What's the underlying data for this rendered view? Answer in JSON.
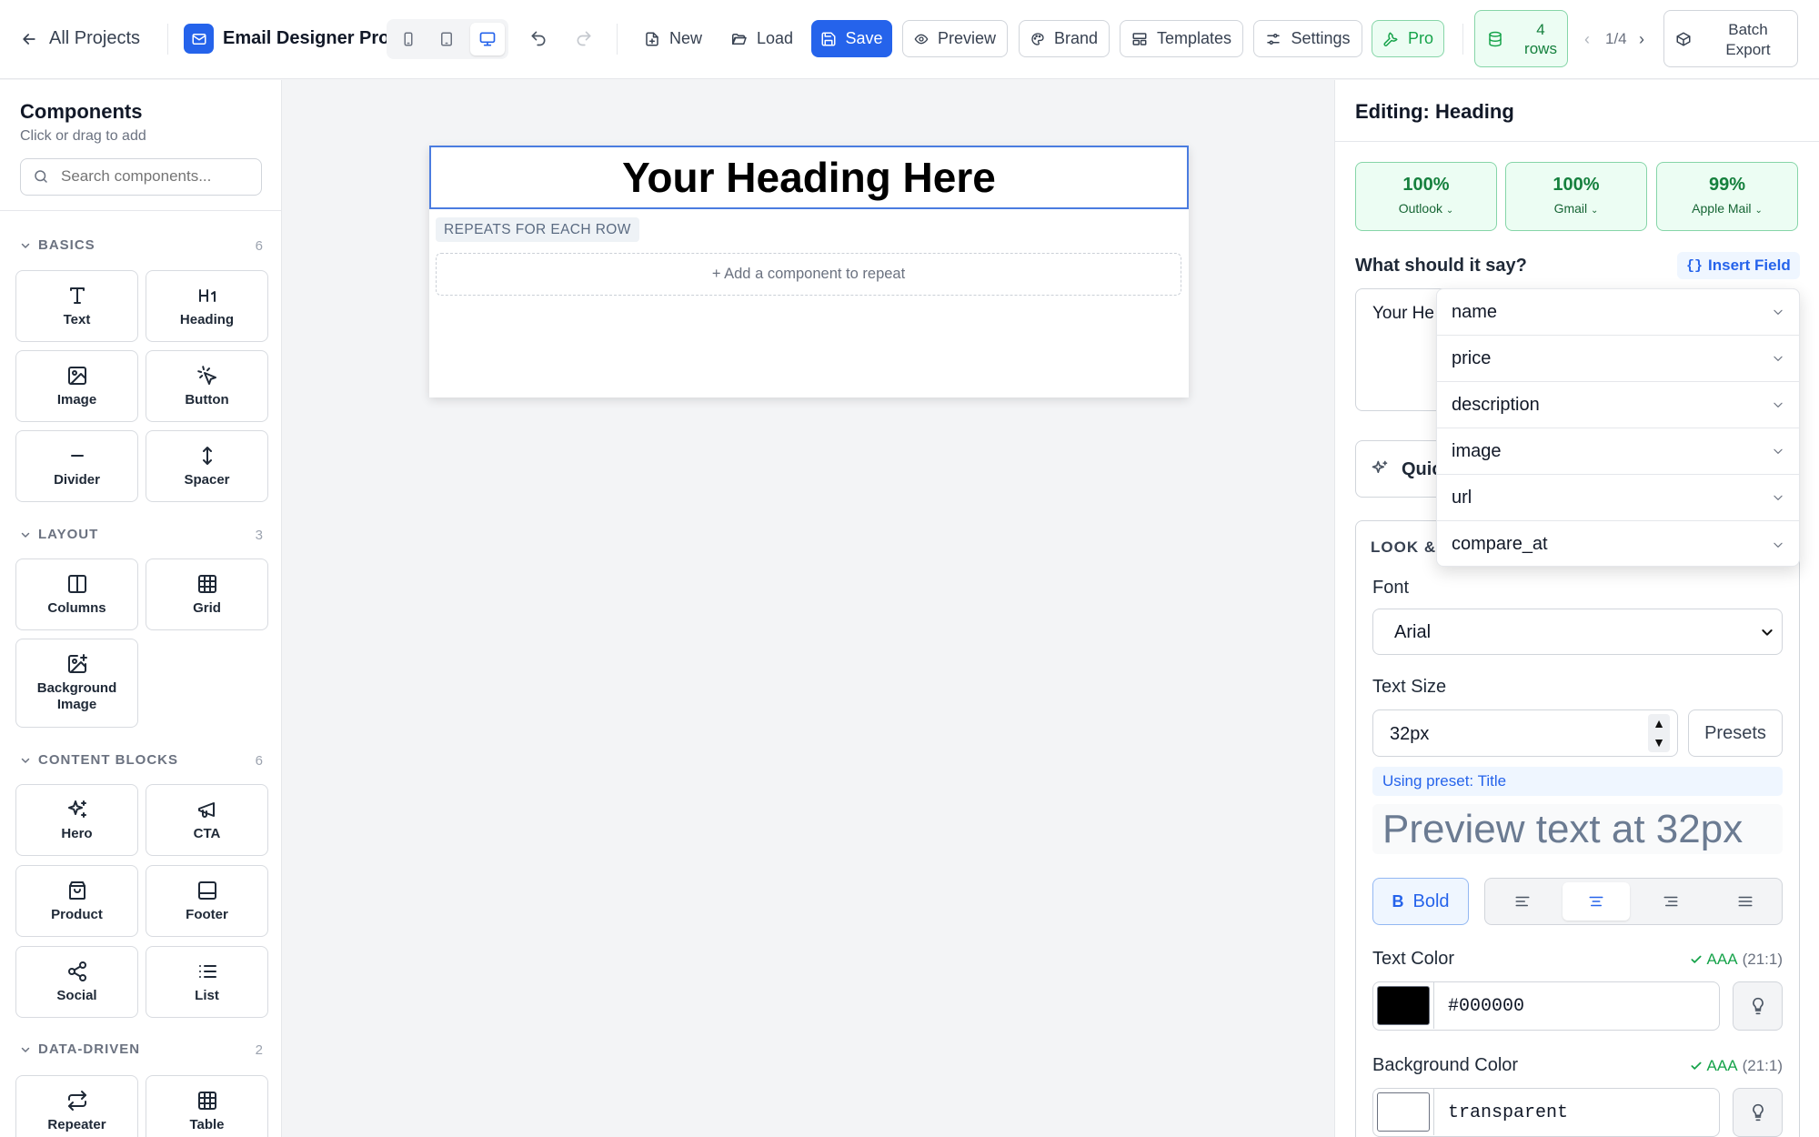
{
  "header": {
    "back_label": "All Projects",
    "app_title": "Email Designer Pro",
    "undo_icon": "undo-icon",
    "redo_icon": "redo-icon",
    "buttons": {
      "new": "New",
      "load": "Load",
      "save": "Save",
      "preview": "Preview",
      "brand": "Brand",
      "templates": "Templates",
      "settings": "Settings",
      "pro": "Pro"
    },
    "rows_count": "4",
    "rows_label": "rows",
    "pager": "1/4",
    "batch_line1": "Batch",
    "batch_line2": "Export",
    "colors": {
      "accent": "#2563eb",
      "pro": "#16a34a"
    }
  },
  "sidebar": {
    "title": "Components",
    "subtitle": "Click or drag to add",
    "search_placeholder": "Search components...",
    "sections": {
      "basics": {
        "label": "BASICS",
        "count": "6",
        "items": [
          "Text",
          "Heading",
          "Image",
          "Button",
          "Divider",
          "Spacer"
        ]
      },
      "layout": {
        "label": "LAYOUT",
        "count": "3",
        "items": [
          "Columns",
          "Grid",
          "Background Image"
        ]
      },
      "content": {
        "label": "CONTENT BLOCKS",
        "count": "6",
        "items": [
          "Hero",
          "CTA",
          "Product",
          "Footer",
          "Social",
          "List"
        ]
      },
      "data": {
        "label": "DATA-DRIVEN",
        "count": "2",
        "items": [
          "Repeater",
          "Table"
        ]
      }
    }
  },
  "canvas": {
    "heading": "Your Heading Here",
    "repeat_tag": "REPEATS FOR EACH ROW",
    "add_repeat": "+ Add a component to repeat"
  },
  "panel": {
    "title": "Editing: Heading",
    "compat": [
      {
        "pct": "100%",
        "client": "Outlook"
      },
      {
        "pct": "100%",
        "client": "Gmail"
      },
      {
        "pct": "99%",
        "client": "Apple Mail"
      }
    ],
    "say_label": "What should it say?",
    "insert_field": "Insert Field",
    "text_value": "Your He",
    "quick_label": "Quic",
    "look_label": "LOOK &",
    "fields_dropdown": [
      "name",
      "price",
      "description",
      "image",
      "url",
      "compare_at"
    ],
    "font_label": "Font",
    "font_value": "Arial",
    "size_label": "Text Size",
    "size_value": "32px",
    "presets": "Presets",
    "preset_note": "Using preset: Title",
    "preview_text": "Preview text at 32px",
    "bold": "Bold",
    "text_color_label": "Text Color",
    "text_color_value": "#000000",
    "text_color_contrast": "AAA",
    "text_color_ratio": "(21:1)",
    "bg_color_label": "Background Color",
    "bg_color_value": "transparent",
    "bg_color_contrast": "AAA",
    "bg_color_ratio": "(21:1)"
  }
}
